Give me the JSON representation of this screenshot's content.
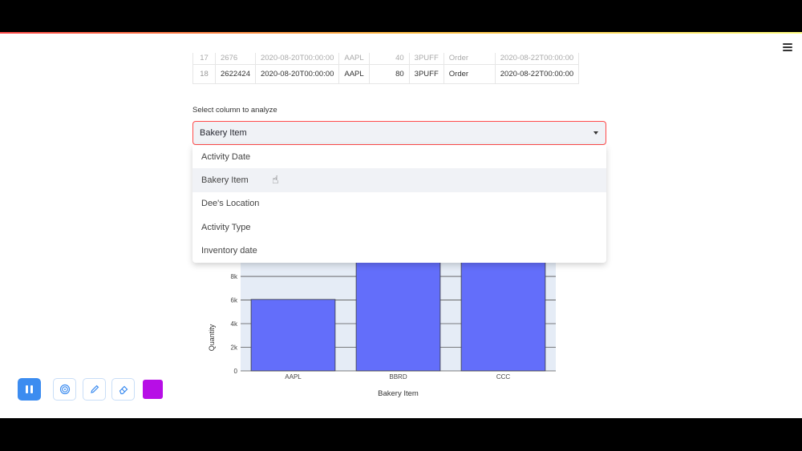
{
  "table": {
    "ghost_row": [
      "17",
      "2676",
      "2020-08-20T00:00:00",
      "AAPL",
      "40",
      "3PUFF",
      "Order",
      "2020-08-22T00:00:00"
    ],
    "rows": [
      [
        "18",
        "2622424",
        "2020-08-20T00:00:00",
        "AAPL",
        "80",
        "3PUFF",
        "Order",
        "2020-08-22T00:00:00"
      ]
    ]
  },
  "select": {
    "label": "Select column to analyze",
    "value": "Bakery Item",
    "options": [
      "Activity Date",
      "Bakery Item",
      "Dee's Location",
      "Activity Type",
      "Inventory date"
    ],
    "hover_index": 1
  },
  "chart_data": {
    "type": "bar",
    "categories": [
      "AAPL",
      "BBRD",
      "CCC"
    ],
    "values": [
      6050,
      11000,
      11000
    ],
    "xlabel": "Bakery Item",
    "ylabel": "Quantity",
    "ylim": [
      0,
      9700
    ],
    "yticks": [
      0,
      2000,
      4000,
      6000,
      8000
    ],
    "ytick_labels": [
      "0",
      "2k",
      "4k",
      "6k",
      "8k"
    ],
    "bar_color": "#636efa",
    "plot_bg": "#e5ecf6",
    "grid": true
  },
  "toolbar": {
    "buttons": [
      "pause-icon",
      "fingerprint-icon",
      "pencil-icon",
      "eraser-icon"
    ],
    "accent": "#3c8cf0",
    "pen_color": "#b70ee6"
  }
}
